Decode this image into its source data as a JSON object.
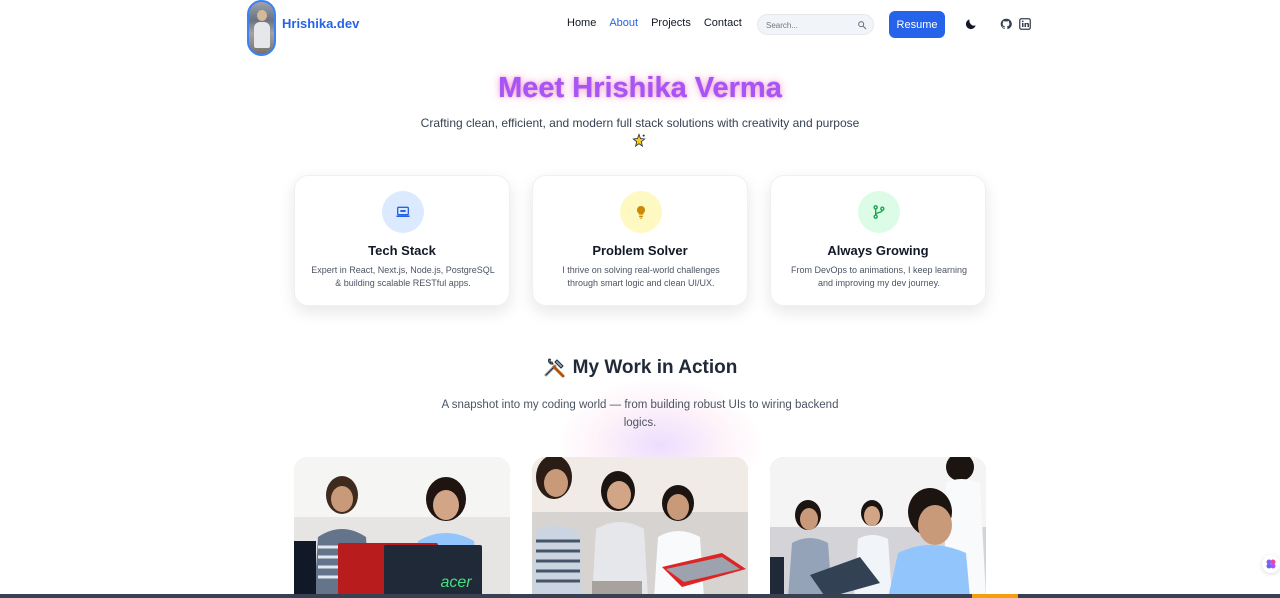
{
  "header": {
    "brand": "Hrishika.dev",
    "nav": [
      {
        "label": "Home",
        "active": false
      },
      {
        "label": "About",
        "active": true
      },
      {
        "label": "Projects",
        "active": false
      },
      {
        "label": "Contact",
        "active": false
      }
    ],
    "search_placeholder": "Search...",
    "resume_label": "Resume",
    "icons": [
      "moon-icon",
      "github-icon",
      "linkedin-icon"
    ]
  },
  "hero": {
    "title": "Meet Hrishika Verma",
    "subtitle": "Crafting clean, efficient, and modern full stack solutions with creativity and purpose",
    "emoji": "sparkle-icon"
  },
  "cards": [
    {
      "icon": "laptop-icon",
      "title": "Tech Stack",
      "text": "Expert in React, Next.js, Node.js, PostgreSQL & building scalable RESTful apps.",
      "icon_color": "#2563eb",
      "icon_bg": "#dbeafe"
    },
    {
      "icon": "lightbulb-icon",
      "title": "Problem Solver",
      "text": "I thrive on solving real-world challenges through smart logic and clean UI/UX.",
      "icon_color": "#ca8a04",
      "icon_bg": "#fef9c3"
    },
    {
      "icon": "git-branch-icon",
      "title": "Always Growing",
      "text": "From DevOps to animations, I keep learning and improving my dev journey.",
      "icon_color": "#16a34a",
      "icon_bg": "#dcfce7"
    }
  ],
  "section": {
    "title": "My Work in Action",
    "subtitle": "A snapshot into my coding world — from building robust UIs to wiring backend logics."
  },
  "photos": [
    {
      "alt": "team-photo-1",
      "laptop_text": "acer"
    },
    {
      "alt": "team-photo-2"
    },
    {
      "alt": "team-photo-3"
    }
  ],
  "colors": {
    "accent": "#2563eb",
    "title_gradient_start": "#8b5cf6",
    "title_gradient_end": "#c026d3"
  }
}
